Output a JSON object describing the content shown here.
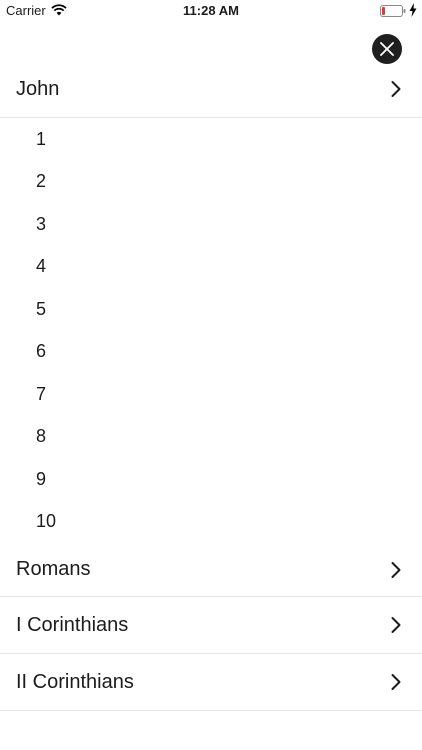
{
  "status_bar": {
    "carrier": "Carrier",
    "time": "11:28 AM",
    "wifi_icon": "wifi-icon",
    "battery_icon": "battery-low-icon",
    "charging_icon": "bolt-icon",
    "battery_color": "#e53935"
  },
  "close_button": {
    "icon": "close-icon"
  },
  "books": [
    {
      "label": "John",
      "expanded": true,
      "chapters": [
        "1",
        "2",
        "3",
        "4",
        "5",
        "6",
        "7",
        "8",
        "9",
        "10"
      ]
    },
    {
      "label": "Romans",
      "expanded": false
    },
    {
      "label": "I Corinthians",
      "expanded": false
    },
    {
      "label": "II Corinthians",
      "expanded": false
    }
  ]
}
